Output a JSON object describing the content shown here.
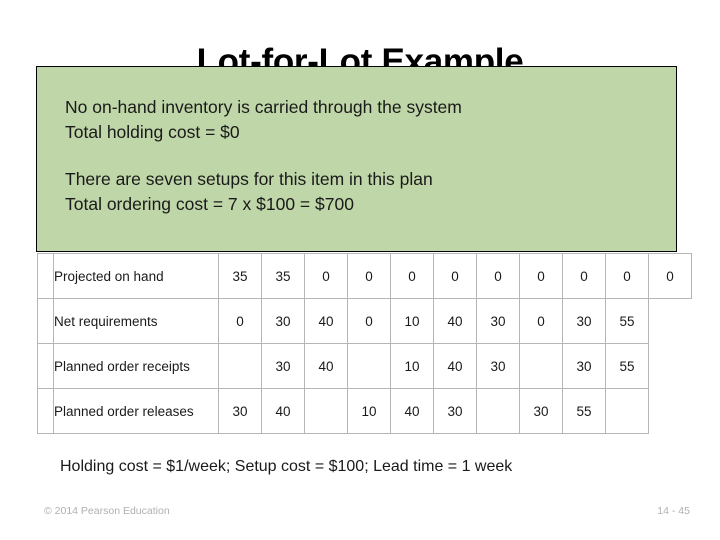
{
  "slide": {
    "title": "Lot-for-Lot Example",
    "callout": {
      "paragraph_1": {
        "line_1": "No on-hand inventory is carried through the system",
        "line_2": "Total holding cost = $0"
      },
      "paragraph_2": {
        "line_1": "There are seven setups for this item in this plan",
        "line_2": "Total ordering cost = 7 x $100 = $700"
      },
      "background_color": "#bfd6a8"
    },
    "bottom_note": "Holding cost = $1/week; Setup cost = $100; Lead time = 1 week",
    "footer": {
      "copyright": "© 2014 Pearson Education",
      "page_number": "14 - 45"
    }
  },
  "table": {
    "rows": [
      {
        "label": "Projected on hand",
        "label_wide": false,
        "values": [
          "35",
          "35",
          "0",
          "0",
          "0",
          "0",
          "0",
          "0",
          "0",
          "0",
          "0"
        ]
      },
      {
        "label": "Net requirements",
        "label_wide": true,
        "values": [
          "0",
          "30",
          "40",
          "0",
          "10",
          "40",
          "30",
          "0",
          "30",
          "55"
        ]
      },
      {
        "label": "Planned order receipts",
        "label_wide": true,
        "values": [
          "",
          "30",
          "40",
          "",
          "10",
          "40",
          "30",
          "",
          "30",
          "55"
        ]
      },
      {
        "label": "Planned order releases",
        "label_wide": true,
        "values": [
          "30",
          "40",
          "",
          "10",
          "40",
          "30",
          "",
          "30",
          "55",
          ""
        ]
      }
    ]
  }
}
